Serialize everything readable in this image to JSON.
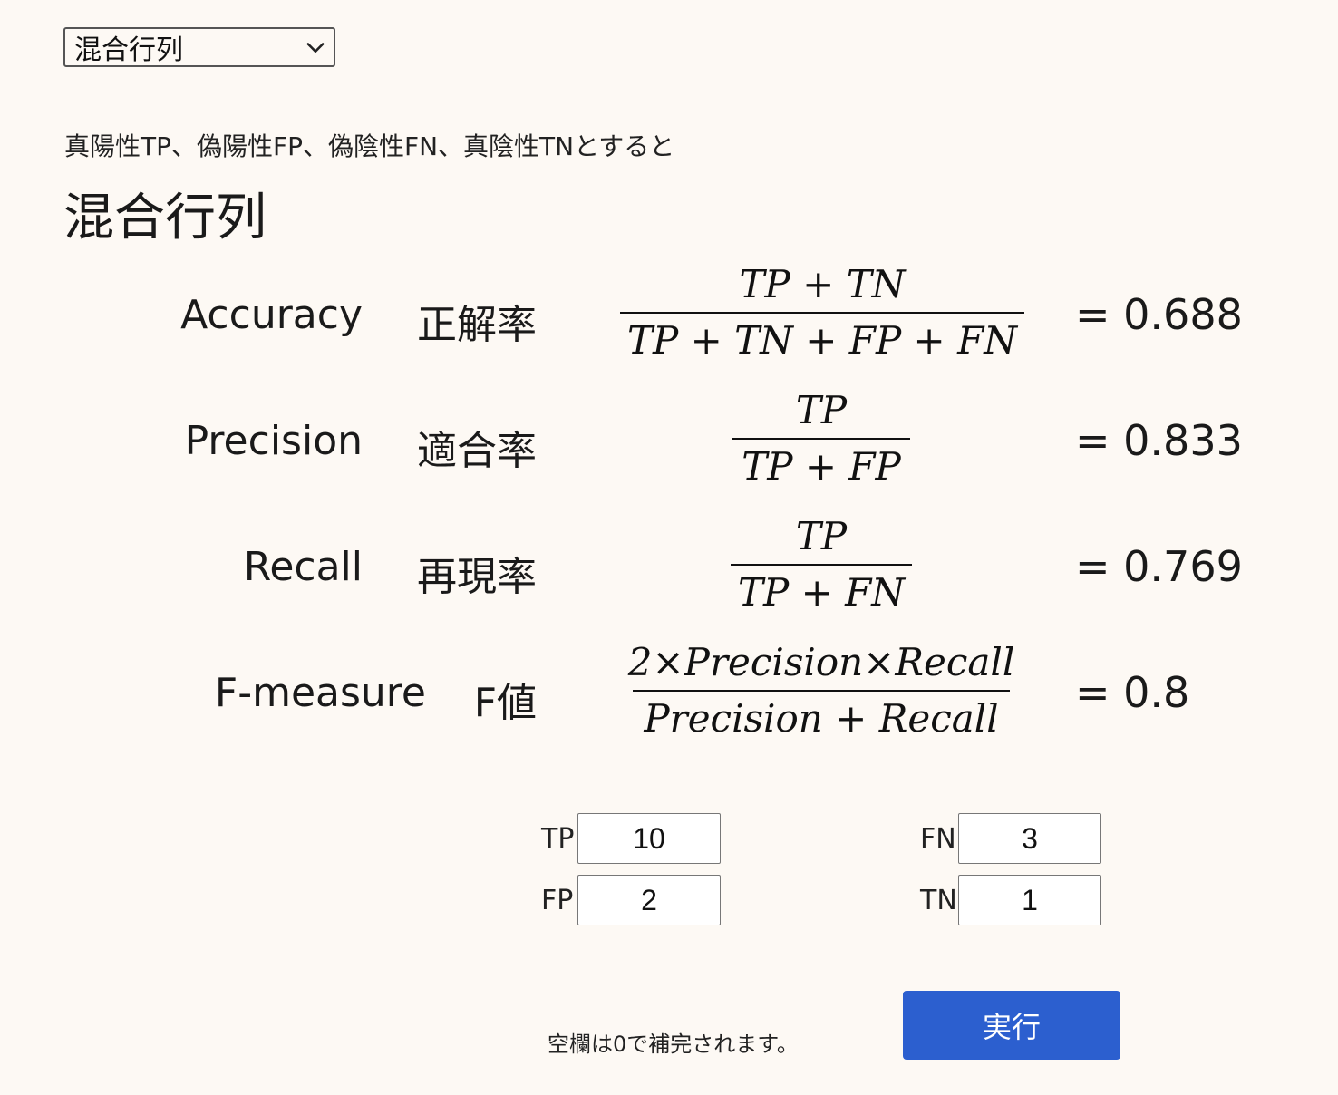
{
  "selector": {
    "value": "混合行列",
    "icon": "chevron-down-icon"
  },
  "intro_text": "真陽性TP、偽陽性FP、偽陰性FN、真陰性TNとすると",
  "section_title": "混合行列",
  "metrics": [
    {
      "name": "Accuracy",
      "ja": "正解率",
      "numerator": "TP + TN",
      "denominator": "TP + TN + FP + FN",
      "result": "= 0.688"
    },
    {
      "name": "Precision",
      "ja": "適合率",
      "numerator": "TP",
      "denominator": "TP + FP",
      "result": "= 0.833"
    },
    {
      "name": "Recall",
      "ja": "再現率",
      "numerator": "TP",
      "denominator": "TP + FN",
      "result": "= 0.769"
    },
    {
      "name": "F-measure",
      "ja": "F値",
      "numerator": "2×Precision×Recall",
      "denominator": "Precision + Recall",
      "result": "= 0.8"
    }
  ],
  "inputs": {
    "tp": {
      "label": "TP",
      "value": "10"
    },
    "fp": {
      "label": "FP",
      "value": "2"
    },
    "fn": {
      "label": "FN",
      "value": "3"
    },
    "tn": {
      "label": "TN",
      "value": "1"
    }
  },
  "note": "空欄は0で補完されます。",
  "run_button": "実行",
  "colors": {
    "background": "#fdf9f4",
    "button": "#2c5fcf",
    "button_text": "#ffffff"
  }
}
